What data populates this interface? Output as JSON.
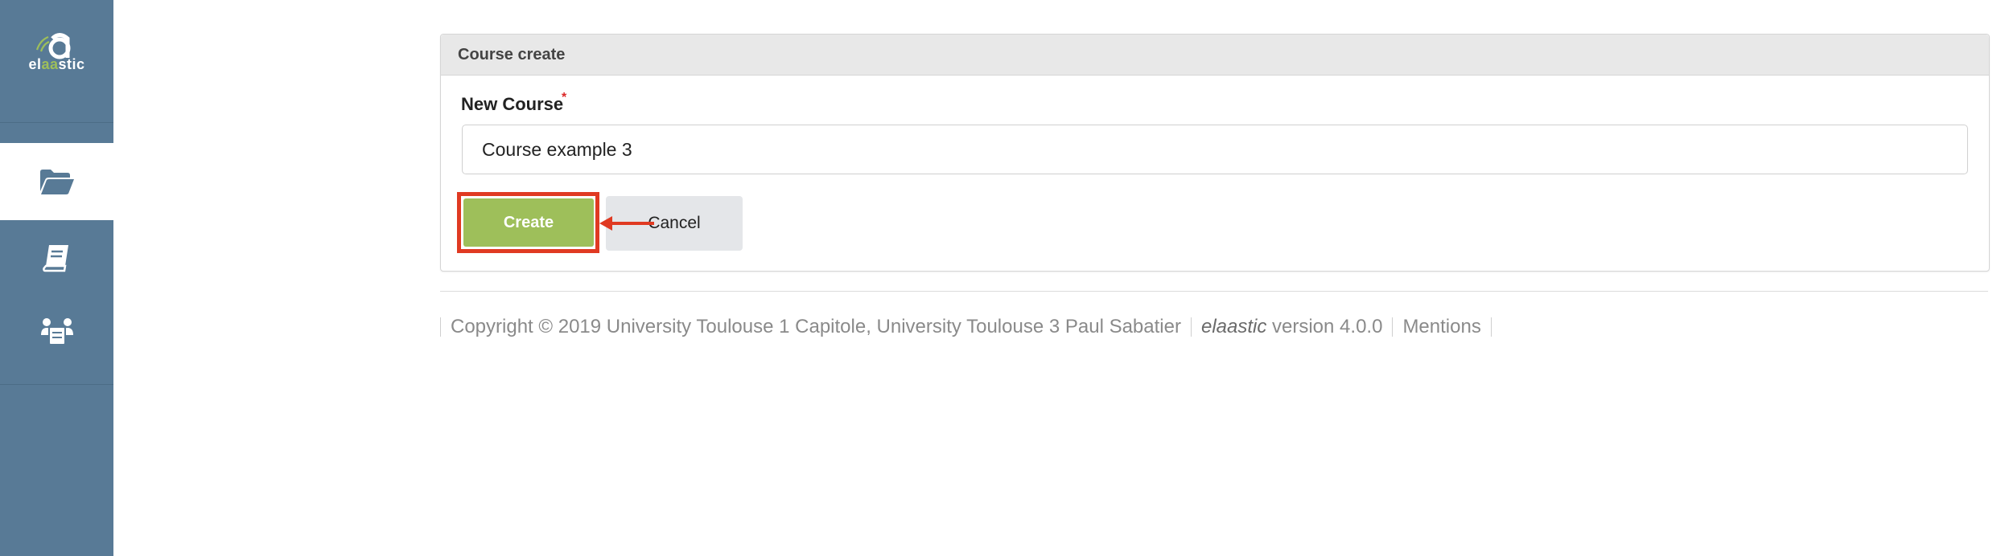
{
  "sidebar": {
    "logo": {
      "prefix": "el",
      "highlight": "aa",
      "suffix": "stic"
    },
    "items": [
      {
        "icon": "folder-open-icon",
        "active": true
      },
      {
        "icon": "book-icon",
        "active": false
      },
      {
        "icon": "people-board-icon",
        "active": false
      }
    ]
  },
  "card": {
    "header": "Course create",
    "field_label": "New Course",
    "required_marker": "*",
    "input_value": "Course example 3",
    "create_label": "Create",
    "cancel_label": "Cancel"
  },
  "footer": {
    "copyright": "Copyright © 2019 University Toulouse 1 Capitole, University Toulouse 3 Paul Sabatier",
    "app_name": "elaastic",
    "version_text": " version 4.0.0",
    "mentions": "Mentions"
  },
  "colors": {
    "sidebar_bg": "#587a96",
    "create_bg": "#9ebf5a",
    "highlight": "#e03a22",
    "required": "#db2828"
  }
}
